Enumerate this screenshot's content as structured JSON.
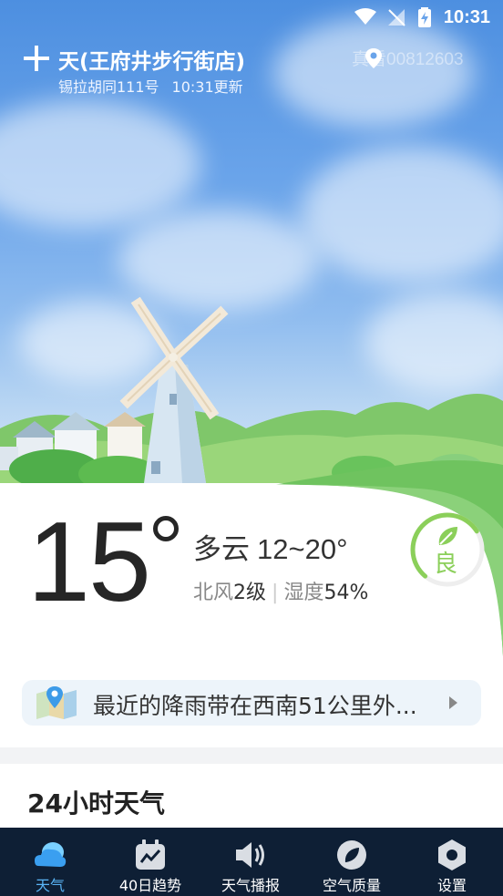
{
  "status_bar": {
    "time": "10:31"
  },
  "header": {
    "location_title": "天(王府井步行街店)",
    "address": "锡拉胡同111号",
    "updated": "10:31更新",
    "customer_id": "真看00812603"
  },
  "current": {
    "temperature": "15",
    "condition": "多云",
    "temp_range": "12~20°",
    "wind_label": "北风",
    "wind_value": "2级",
    "humidity_label": "湿度",
    "humidity_value": "54%",
    "aqi_label": "良",
    "aqi_level": 0.55
  },
  "rain_banner": {
    "text": "最近的降雨带在西南51公里外..."
  },
  "section_24h": {
    "title": "24小时天气"
  },
  "nav": {
    "items": [
      {
        "label": "天气",
        "icon": "cloud-icon",
        "active": true
      },
      {
        "label": "40日趋势",
        "icon": "trend-calendar-icon",
        "active": false
      },
      {
        "label": "天气播报",
        "icon": "speaker-icon",
        "active": false
      },
      {
        "label": "空气质量",
        "icon": "leaf-icon",
        "active": false
      },
      {
        "label": "设置",
        "icon": "hexagon-settings-icon",
        "active": false
      }
    ]
  },
  "colors": {
    "sky_top": "#4d8fe0",
    "nav_bg": "#0e1f35",
    "nav_active": "#5ab4f5",
    "aqi_green": "#8bcf5a"
  }
}
